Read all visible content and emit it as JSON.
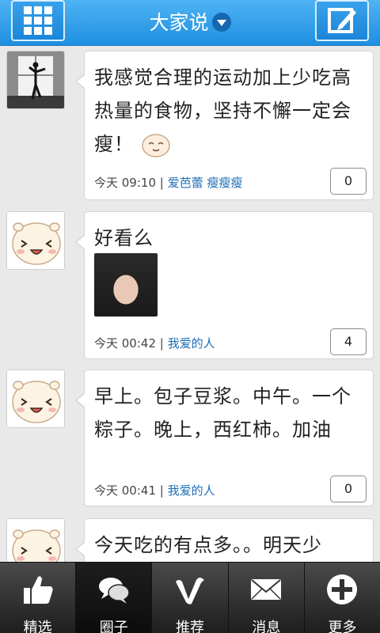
{
  "header": {
    "title": "大家说",
    "menu_icon": "grid-icon",
    "compose_icon": "edit-icon"
  },
  "posts": [
    {
      "text": "我感觉合理的运动加上少吃高热量的食物，坚持不懈一定会瘦！",
      "time": "今天 09:10",
      "author": "爱芭蕾 瘦瘦瘦",
      "count": "0",
      "avatar": "ballet-photo"
    },
    {
      "text": "好看么",
      "time": "今天 00:42",
      "author": "我爱的人",
      "count": "4",
      "avatar": "cartoon-face"
    },
    {
      "text": "早上。包子豆浆。中午。一个粽子。晚上，西红柿。加油",
      "time": "今天 00:41",
      "author": "我爱的人",
      "count": "0",
      "avatar": "cartoon-face"
    },
    {
      "text": "今天吃的有点多。。明天少",
      "avatar": "cartoon-face"
    }
  ],
  "tabs": [
    {
      "label": "精选",
      "icon": "thumbs-up-icon"
    },
    {
      "label": "圈子",
      "icon": "chat-bubbles-icon"
    },
    {
      "label": "推荐",
      "icon": "v-icon"
    },
    {
      "label": "消息",
      "icon": "envelope-icon"
    },
    {
      "label": "更多",
      "icon": "plus-icon"
    }
  ],
  "colors": {
    "header": "#1e8fe0",
    "author": "#1f6fb8",
    "tabbar": "#2a2a2a"
  }
}
